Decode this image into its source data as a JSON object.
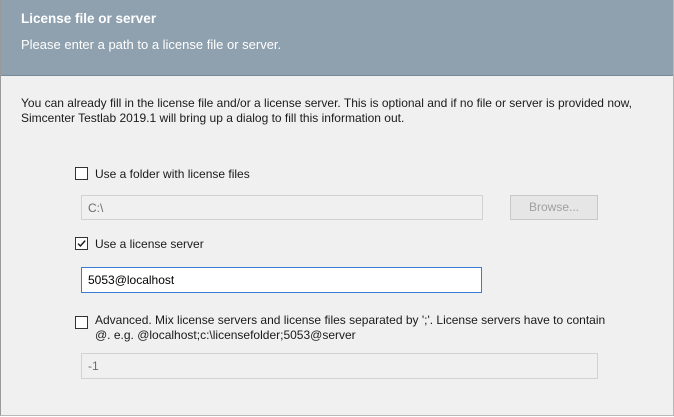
{
  "header": {
    "title": "License file or server",
    "subtitle": "Please enter a path to a license file or server."
  },
  "intro": {
    "text": "You can already fill in the license file and/or a license server. This is optional and if no file or server is provided now, Simcenter Testlab 2019.1 will bring up a dialog to fill this information out."
  },
  "folder_option": {
    "label": "Use a folder with license files",
    "checked": false,
    "path_value": "C:\\",
    "browse_label": "Browse..."
  },
  "server_option": {
    "label": "Use a license server",
    "checked": true,
    "server_value": "5053@localhost"
  },
  "advanced_option": {
    "label": "Advanced. Mix license servers and license files separated by ';'. License servers have to contain @. e.g. @localhost;c:\\licensefolder;5053@server",
    "checked": false,
    "value": "-1"
  },
  "colors": {
    "header_bg": "#8fa0af",
    "body_bg": "#f0f0f0",
    "focus_border": "#3a7bd5"
  }
}
